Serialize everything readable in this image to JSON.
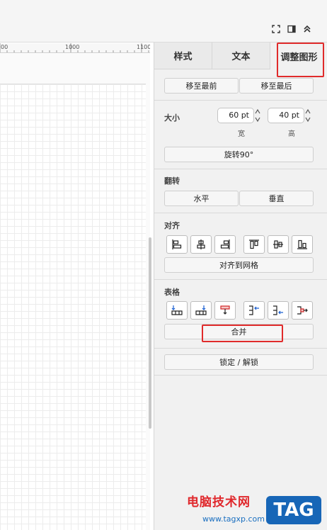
{
  "toolbar": {
    "icons": [
      "fullscreen-icon",
      "panel-toggle-icon",
      "collapse-up-icon"
    ]
  },
  "ruler": {
    "labels": [
      "00",
      "1000",
      "1100"
    ]
  },
  "tabs": [
    {
      "label": "样式",
      "active": false
    },
    {
      "label": "文本",
      "active": false
    },
    {
      "label": "调整图形",
      "active": true
    }
  ],
  "arrange": {
    "to_front": "移至最前",
    "to_back": "移至最后"
  },
  "size": {
    "title": "大小",
    "width_value": "60 pt",
    "height_value": "40 pt",
    "width_label": "宽",
    "height_label": "高",
    "rotate": "旋转90°"
  },
  "flip": {
    "title": "翻转",
    "horizontal": "水平",
    "vertical": "垂直"
  },
  "align": {
    "title": "对齐",
    "icons": [
      "align-left-icon",
      "align-center-icon",
      "align-right-icon",
      "align-top-icon",
      "align-middle-icon",
      "align-bottom-icon"
    ],
    "to_grid": "对齐到网格"
  },
  "table": {
    "title": "表格",
    "icons": [
      "insert-row-before-icon",
      "insert-row-after-icon",
      "delete-row-icon",
      "insert-column-before-icon",
      "insert-column-after-icon",
      "delete-column-icon"
    ],
    "merge": "合并"
  },
  "lock": {
    "label": "锁定 / 解锁"
  },
  "watermark": {
    "text": "电脑技术网",
    "url": "www.tagxp.com",
    "tag": "TAG"
  },
  "colors": {
    "highlight": "#e02b2b",
    "panel_bg": "#f1f1f1"
  }
}
